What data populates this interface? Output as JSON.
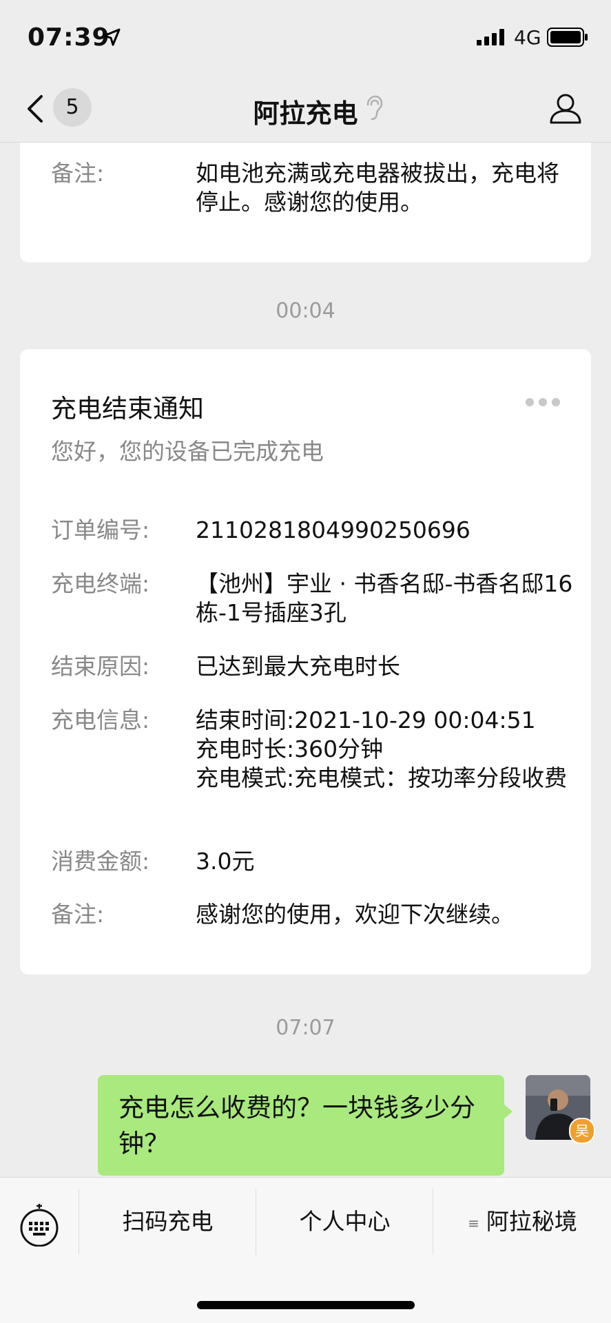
{
  "status_bar": {
    "time": "07:39",
    "network": "4G",
    "icons": [
      "location-arrow-icon",
      "signal-bars-icon",
      "battery-icon"
    ]
  },
  "nav": {
    "unread_count": "5",
    "title": "阿拉充电",
    "icons": [
      "back-chevron-icon",
      "ear-icon",
      "profile-icon"
    ]
  },
  "top_card": {
    "remark_label": "备注:",
    "remark_value": "如电池充满或充电器被拔出，充电将停止。感谢您的使用。"
  },
  "timestamps": {
    "first": "00:04",
    "second": "07:07"
  },
  "notice_card": {
    "title": "充电结束通知",
    "subtitle": "您好，您的设备已完成充电",
    "rows": [
      {
        "label": "订单编号:",
        "value": "2110281804990250696"
      },
      {
        "label": "充电终端:",
        "value": "【池州】宇业 · 书香名邸-书香名邸16栋-1号插座3孔"
      },
      {
        "label": "结束原因:",
        "value": "已达到最大充电时长"
      },
      {
        "label": "充电信息:",
        "value_lines": [
          "结束时间:2021-10-29 00:04:51",
          "充电时长:360分钟",
          "充电模式:充电模式：按功率分段收费"
        ]
      },
      {
        "label": "消费金额:",
        "value": "3.0元"
      },
      {
        "label": "备注:",
        "value": "感谢您的使用，欢迎下次继续。"
      }
    ]
  },
  "message": {
    "text": "充电怎么收费的？一块钱多少分钟？",
    "avatar_badge": "吴"
  },
  "menu": {
    "items": [
      "扫码充电",
      "个人中心",
      "阿拉秘境"
    ],
    "submenu_mark": "≡"
  },
  "colors": {
    "bubble": "#a9e97d",
    "background": "#ededed",
    "card": "#ffffff",
    "label_gray": "#888888"
  }
}
